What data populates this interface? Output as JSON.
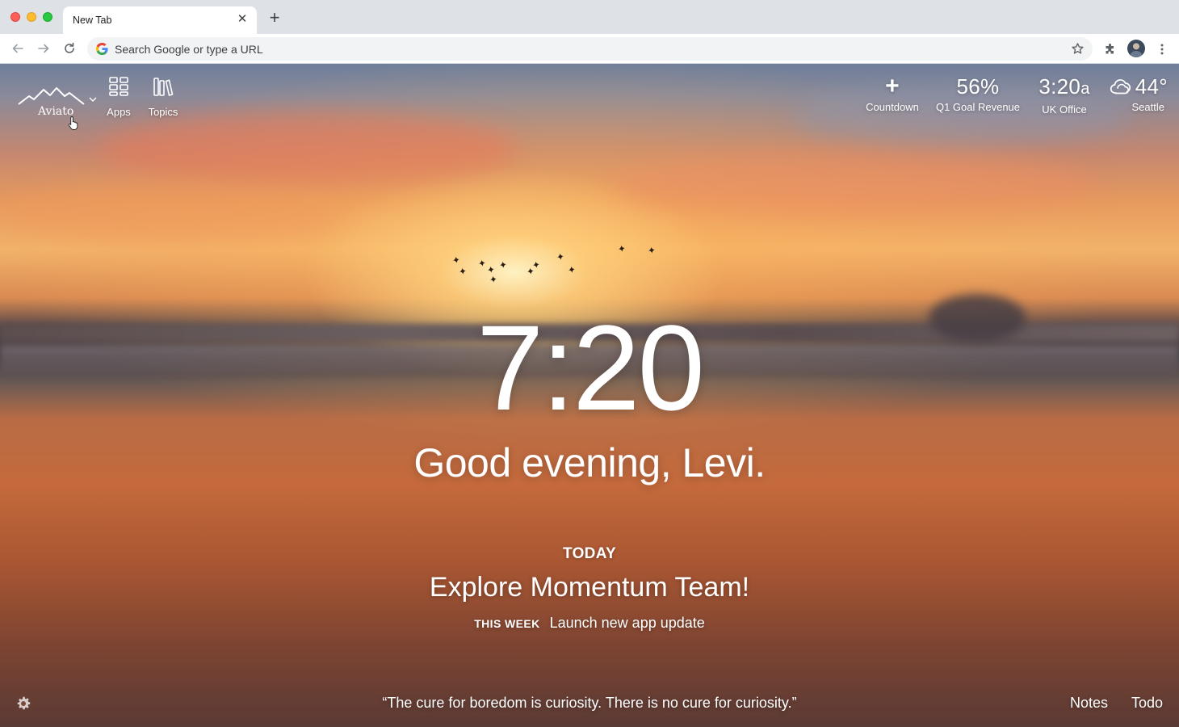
{
  "browser": {
    "tab_title": "New Tab",
    "omnibox_placeholder": "Search Google or type a URL"
  },
  "dashboard": {
    "logo_text": "Aviato",
    "apps_label": "Apps",
    "topics_label": "Topics",
    "metrics": [
      {
        "value": "+",
        "label": "Countdown"
      },
      {
        "value": "56%",
        "label": "Q1 Goal Revenue"
      },
      {
        "value": "3:20",
        "suffix": "a",
        "label": "UK Office"
      },
      {
        "value": "44°",
        "label": "Seattle"
      }
    ],
    "clock": "7:20",
    "greeting": "Good evening, Levi.",
    "today_label": "TODAY",
    "focus": "Explore Momentum Team!",
    "week_label": "THIS WEEK",
    "week_goal": "Launch new app update",
    "quote": "“The cure for boredom is curiosity. There is no cure for curiosity.”",
    "notes_label": "Notes",
    "todo_label": "Todo"
  },
  "colors": {
    "tabstrip": "#dee1e6",
    "toolbar": "#ffffff",
    "omnibox": "#f1f3f4"
  }
}
